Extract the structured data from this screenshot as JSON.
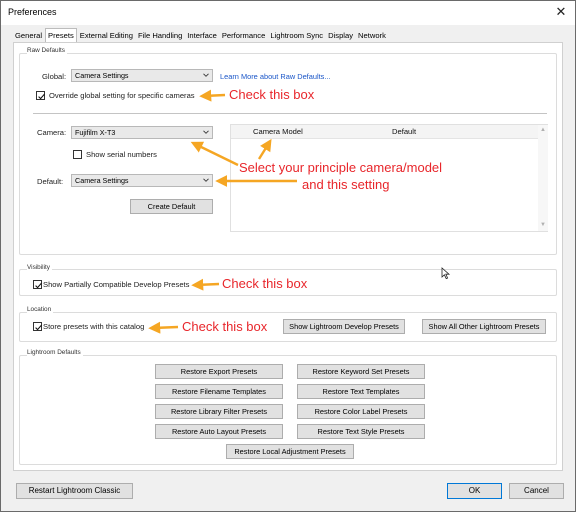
{
  "window": {
    "title": "Preferences"
  },
  "tabs": [
    "General",
    "Presets",
    "External Editing",
    "File Handling",
    "Interface",
    "Performance",
    "Lightroom Sync",
    "Display",
    "Network"
  ],
  "active_tab": "Presets",
  "raw_defaults": {
    "group_label": "Raw Defaults",
    "global_label": "Global:",
    "global_value": "Camera Settings",
    "learn_more_link": "Learn More about Raw Defaults...",
    "override_label": "Override global setting for specific cameras",
    "override_checked": true,
    "camera_label": "Camera:",
    "camera_value": "Fujifilm X-T3",
    "serial_label": "Show serial numbers",
    "serial_checked": false,
    "default_label": "Default:",
    "default_value": "Camera Settings",
    "create_default_button": "Create Default",
    "table_columns": [
      "Camera Model",
      "Default"
    ]
  },
  "visibility": {
    "group_label": "Visibility",
    "partial_label": "Show Partially Compatible Develop Presets",
    "partial_checked": true
  },
  "location": {
    "group_label": "Location",
    "store_label": "Store presets with this catalog",
    "store_checked": true,
    "show_develop_button": "Show Lightroom Develop Presets",
    "show_all_button": "Show All Other Lightroom Presets"
  },
  "lightroom_defaults": {
    "group_label": "Lightroom Defaults",
    "buttons": [
      "Restore Export Presets",
      "Restore Keyword Set Presets",
      "Restore Filename Templates",
      "Restore Text Templates",
      "Restore Library Filter Presets",
      "Restore Color Label Presets",
      "Restore Auto Layout Presets",
      "Restore Text Style Presets",
      "Restore Local Adjustment Presets"
    ]
  },
  "footer": {
    "restart_button": "Restart Lightroom Classic",
    "ok_button": "OK",
    "cancel_button": "Cancel"
  },
  "annotations": {
    "check_1": "Check this box",
    "select_line1": "Select your principle camera/model",
    "select_line2": "and this setting",
    "check_2": "Check this box",
    "check_3": "Check this box",
    "color": "#e8262b",
    "arrow_color": "#f5a623"
  }
}
